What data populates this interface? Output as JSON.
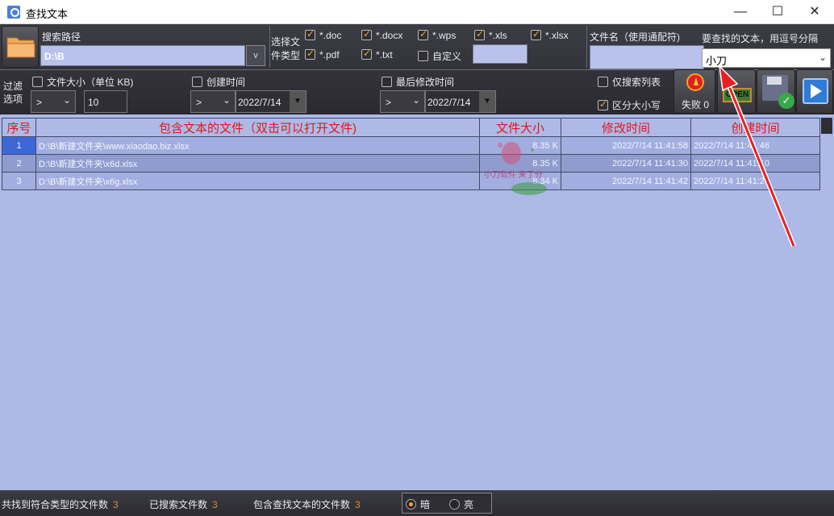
{
  "window": {
    "title": "查找文本",
    "minimize": "—",
    "maximize": "☐",
    "close": "✕"
  },
  "toolbar": {
    "search_path_label": "搜索路径",
    "search_path_value": "D:\\B",
    "path_dropdown": "v",
    "file_type_label_line1": "选择文",
    "file_type_label_line2": "件类型",
    "types": [
      {
        "label": "*.doc",
        "checked": true
      },
      {
        "label": "*.docx",
        "checked": true
      },
      {
        "label": "*.wps",
        "checked": true
      },
      {
        "label": "*.xls",
        "checked": true
      },
      {
        "label": "*.xlsx",
        "checked": true
      },
      {
        "label": "*.pdf",
        "checked": true
      },
      {
        "label": "*.txt",
        "checked": true
      },
      {
        "label": "自定义",
        "checked": false
      }
    ],
    "custom_ext_value": "",
    "filename_label": "文件名（使用通配符)",
    "filename_value": "",
    "search_text_label": "要查找的文本，用逗号分隔",
    "search_text_value": "小刀",
    "filter_label_line1": "过滤",
    "filter_label_line2": "选项",
    "filesize": {
      "label": "文件大小（单位 KB)",
      "checked": false,
      "op": ">",
      "value": "10"
    },
    "created": {
      "label": "创建时间",
      "checked": false,
      "op": ">",
      "date": "2022/7/14"
    },
    "modified": {
      "label": "最后修改时间",
      "checked": false,
      "op": ">",
      "date": "2022/7/14"
    },
    "list_only": {
      "label": "仅搜索列表",
      "checked": false
    },
    "case_sensitive": {
      "label": "区分大小写",
      "checked": true
    },
    "fail_label": "失败 0",
    "open_sign": "OPEN"
  },
  "table": {
    "headers": [
      "序号",
      "包含文本的文件（双击可以打开文件)",
      "文件大小",
      "修改时间",
      "创建时间"
    ],
    "rows": [
      {
        "index": "1",
        "file": "D:\\B\\新建文件夹\\www.xiaodao.biz.xlsx",
        "size": "8.35 K",
        "modified": "2022/7/14 11:41:58",
        "created": "2022/7/14 11:41:46"
      },
      {
        "index": "2",
        "file": "D:\\B\\新建文件夹\\x6d.xlsx",
        "size": "8.35 K",
        "modified": "2022/7/14 11:41:30",
        "created": "2022/7/14 11:41:10"
      },
      {
        "index": "3",
        "file": "D:\\B\\新建文件夹\\x6g.xlsx",
        "size": "8.34 K",
        "modified": "2022/7/14 11:41:42",
        "created": "2022/7/14 11:41:24"
      }
    ]
  },
  "status": {
    "found_label": "共找到符合类型的文件数",
    "found_count": "3",
    "searched_label": "已搜索文件数",
    "searched_count": "3",
    "contain_label": "包含查找文本的文件数",
    "contain_count": "3",
    "theme_dark": "暗",
    "theme_light": "亮",
    "theme_selected": "dark"
  },
  "watermark_text": "小刀软件 来了分",
  "colors": {
    "toolbar_bg": "#2e2e34",
    "table_bg": "#aeb9e8",
    "header_text": "#e01818",
    "accent_orange": "#f0a828",
    "selected_row": "#3d67d4",
    "annotation_arrow": "#e82020"
  }
}
